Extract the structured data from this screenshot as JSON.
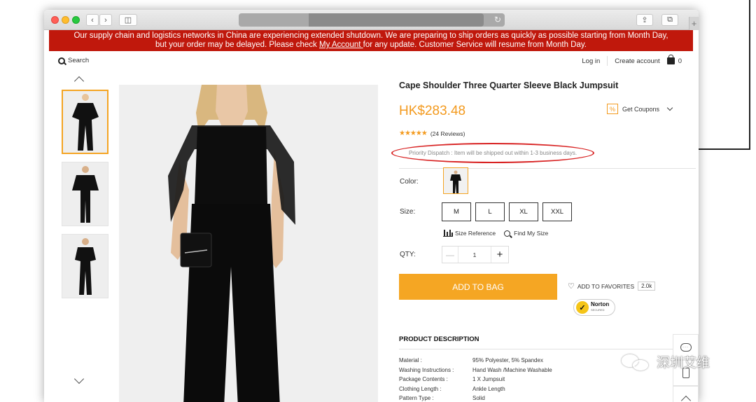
{
  "browser": {
    "back_label": "‹",
    "forward_label": "›",
    "sidebar_label": "◫",
    "reload_label": "↻",
    "share_label": "⇪",
    "tabs_label": "⧉",
    "new_tab_label": "+"
  },
  "banner": {
    "line1": "Our supply chain and logistics networks in China are experiencing extended shutdown. We are preparing to ship orders as quickly as possible starting from Month Day,",
    "line2_before": "but your order may be delayed. Please check ",
    "link": "My Account ",
    "line2_after": "for any update. Customer Service will resume from Month Day."
  },
  "header": {
    "search_label": "Search",
    "login_label": "Log in",
    "create_account_label": "Create account",
    "bag_count": "0"
  },
  "product": {
    "title": "Cape Shoulder Three Quarter Sleeve Black Jumpsuit",
    "price": "HK$283.48",
    "coupon_label": "Get Coupons",
    "coupon_icon": "%",
    "stars": "★★★★★",
    "reviews": "(24 Reviews)",
    "dispatch": "Priority Dispatch : Item will be shipped out within 1-3 business days.",
    "color_label": "Color:",
    "size_label": "Size:",
    "sizes": [
      "M",
      "L",
      "XL",
      "XXL"
    ],
    "size_reference": "Size Reference",
    "find_my_size": "Find My Size",
    "qty_label": "QTY:",
    "qty_minus": "—",
    "qty_value": "1",
    "qty_plus": "+",
    "add_to_bag": "ADD TO BAG",
    "favorites_label": "ADD TO FAVORITES",
    "favorites_count": "2.0k",
    "norton_label": "Norton",
    "norton_sub": "SECURED"
  },
  "description": {
    "title": "PRODUCT DESCRIPTION",
    "specs": [
      {
        "key": "Material :",
        "value": "95% Polyester, 5% Spandex"
      },
      {
        "key": "Washing Instructions :",
        "value": "Hand Wash /Machine Washable"
      },
      {
        "key": "Package Contents :",
        "value": "1 X Jumpsuit"
      },
      {
        "key": "Clothing Length :",
        "value": "Ankle Length"
      },
      {
        "key": "Pattern Type :",
        "value": "Solid"
      }
    ]
  },
  "watermark": "深圳艾维",
  "colors": {
    "banner": "#c0180c",
    "accent": "#f5a623",
    "price": "#f39a1e",
    "highlight": "#d82222"
  }
}
